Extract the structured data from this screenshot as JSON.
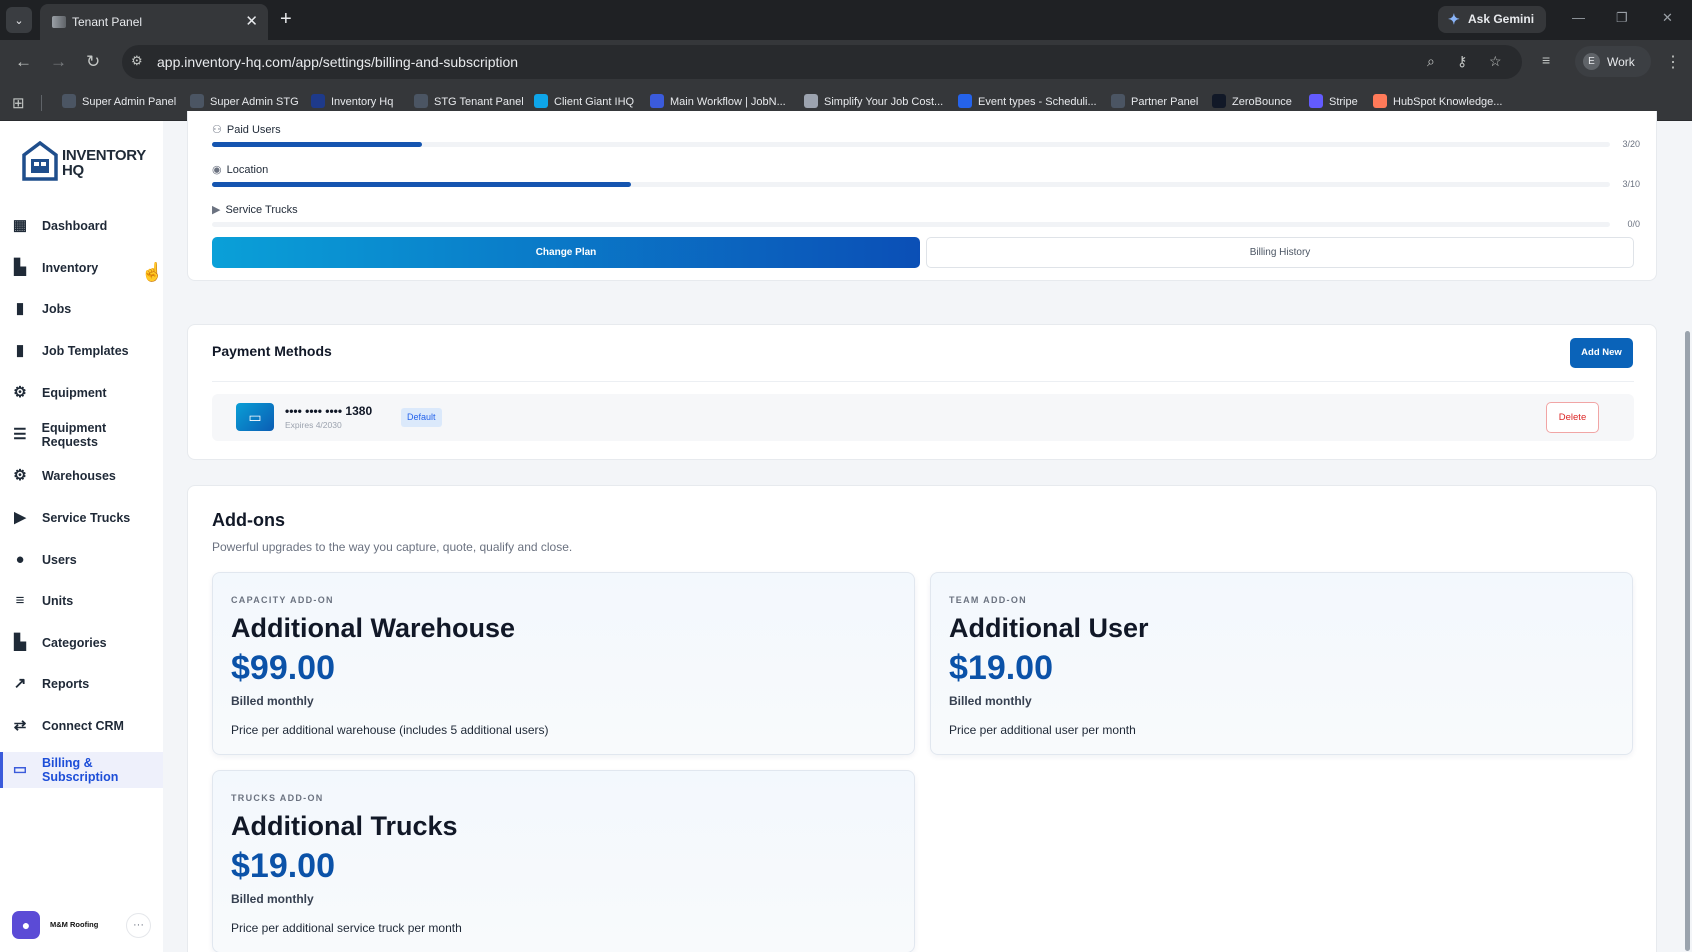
{
  "browser": {
    "tab_title": "Tenant Panel",
    "gemini_label": "Ask Gemini",
    "url": "app.inventory-hq.com/app/settings/billing-and-subscription",
    "profile_initial": "E",
    "profile_label": "Work",
    "bookmarks": [
      {
        "label": "Super Admin Panel",
        "color": "#4b5563"
      },
      {
        "label": "Super Admin STG",
        "color": "#4b5563"
      },
      {
        "label": "Inventory Hq",
        "color": "#1e3a8a"
      },
      {
        "label": "STG Tenant Panel",
        "color": "#4b5563"
      },
      {
        "label": "Client Giant IHQ",
        "color": "#0ea5e9"
      },
      {
        "label": "Main Workflow | JobN...",
        "color": "#3b5bdb"
      },
      {
        "label": "Simplify Your Job Cost...",
        "color": "#9ca3af"
      },
      {
        "label": "Event types - Scheduli...",
        "color": "#2563eb"
      },
      {
        "label": "Partner Panel",
        "color": "#4b5563"
      },
      {
        "label": "ZeroBounce",
        "color": "#111827"
      },
      {
        "label": "Stripe",
        "color": "#635bff"
      },
      {
        "label": "HubSpot Knowledge...",
        "color": "#ff7a59"
      }
    ]
  },
  "sidebar": {
    "logo_text": "INVENTORY HQ",
    "items": [
      {
        "label": "Dashboard",
        "icon": "grid-icon",
        "glyph": "▦"
      },
      {
        "label": "Inventory",
        "icon": "inventory-icon",
        "glyph": "▙"
      },
      {
        "label": "Jobs",
        "icon": "briefcase-icon",
        "glyph": "▮"
      },
      {
        "label": "Job Templates",
        "icon": "template-icon",
        "glyph": "▮"
      },
      {
        "label": "Equipment",
        "icon": "wrench-icon",
        "glyph": "⚙"
      },
      {
        "label": "Equipment Requests",
        "icon": "request-list-icon",
        "glyph": "☰"
      },
      {
        "label": "Warehouses",
        "icon": "warehouse-icon",
        "glyph": "⚙"
      },
      {
        "label": "Service Trucks",
        "icon": "truck-icon",
        "glyph": "▶"
      },
      {
        "label": "Users",
        "icon": "users-icon",
        "glyph": "●"
      },
      {
        "label": "Units",
        "icon": "units-icon",
        "glyph": "≡"
      },
      {
        "label": "Categories",
        "icon": "categories-icon",
        "glyph": "▙"
      },
      {
        "label": "Reports",
        "icon": "reports-icon",
        "glyph": "↗"
      },
      {
        "label": "Connect CRM",
        "icon": "connect-icon",
        "glyph": "⇄"
      },
      {
        "label": "Billing & Subscription",
        "icon": "credit-card-icon",
        "glyph": "▭",
        "active": true
      }
    ],
    "tenant_name": "M&M Roofing",
    "tenant_more": "···"
  },
  "usage": {
    "rows": [
      {
        "label": "Paid Users",
        "icon": "users-outline-icon",
        "glyph": "⚇",
        "count": "3/20",
        "progress": 0.15
      },
      {
        "label": "Location",
        "icon": "pin-icon",
        "glyph": "◉",
        "count": "3/10",
        "progress": 0.3
      },
      {
        "label": "Service Trucks",
        "icon": "truck-icon",
        "glyph": "▶",
        "count": "0/0",
        "progress": 0.0
      }
    ],
    "change_plan_label": "Change Plan",
    "billing_history_label": "Billing History"
  },
  "payment_methods": {
    "title": "Payment Methods",
    "add_new_label": "Add New",
    "cards": [
      {
        "number": "•••• •••• •••• 1380",
        "expires": "Expires 4/2030",
        "badge": "Default",
        "delete_label": "Delete"
      }
    ]
  },
  "addons": {
    "title": "Add-ons",
    "subtitle": "Powerful upgrades to the way you capture, quote, qualify and close.",
    "items": [
      {
        "kicker": "CAPACITY ADD-ON",
        "name": "Additional Warehouse",
        "price": "$99.00",
        "billing": "Billed monthly",
        "description": "Price per additional warehouse (includes 5 additional users)"
      },
      {
        "kicker": "TEAM ADD-ON",
        "name": "Additional User",
        "price": "$19.00",
        "billing": "Billed monthly",
        "description": "Price per additional user per month"
      },
      {
        "kicker": "TRUCKS ADD-ON",
        "name": "Additional Trucks",
        "price": "$19.00",
        "billing": "Billed monthly",
        "description": "Price per additional service truck per month"
      }
    ]
  }
}
